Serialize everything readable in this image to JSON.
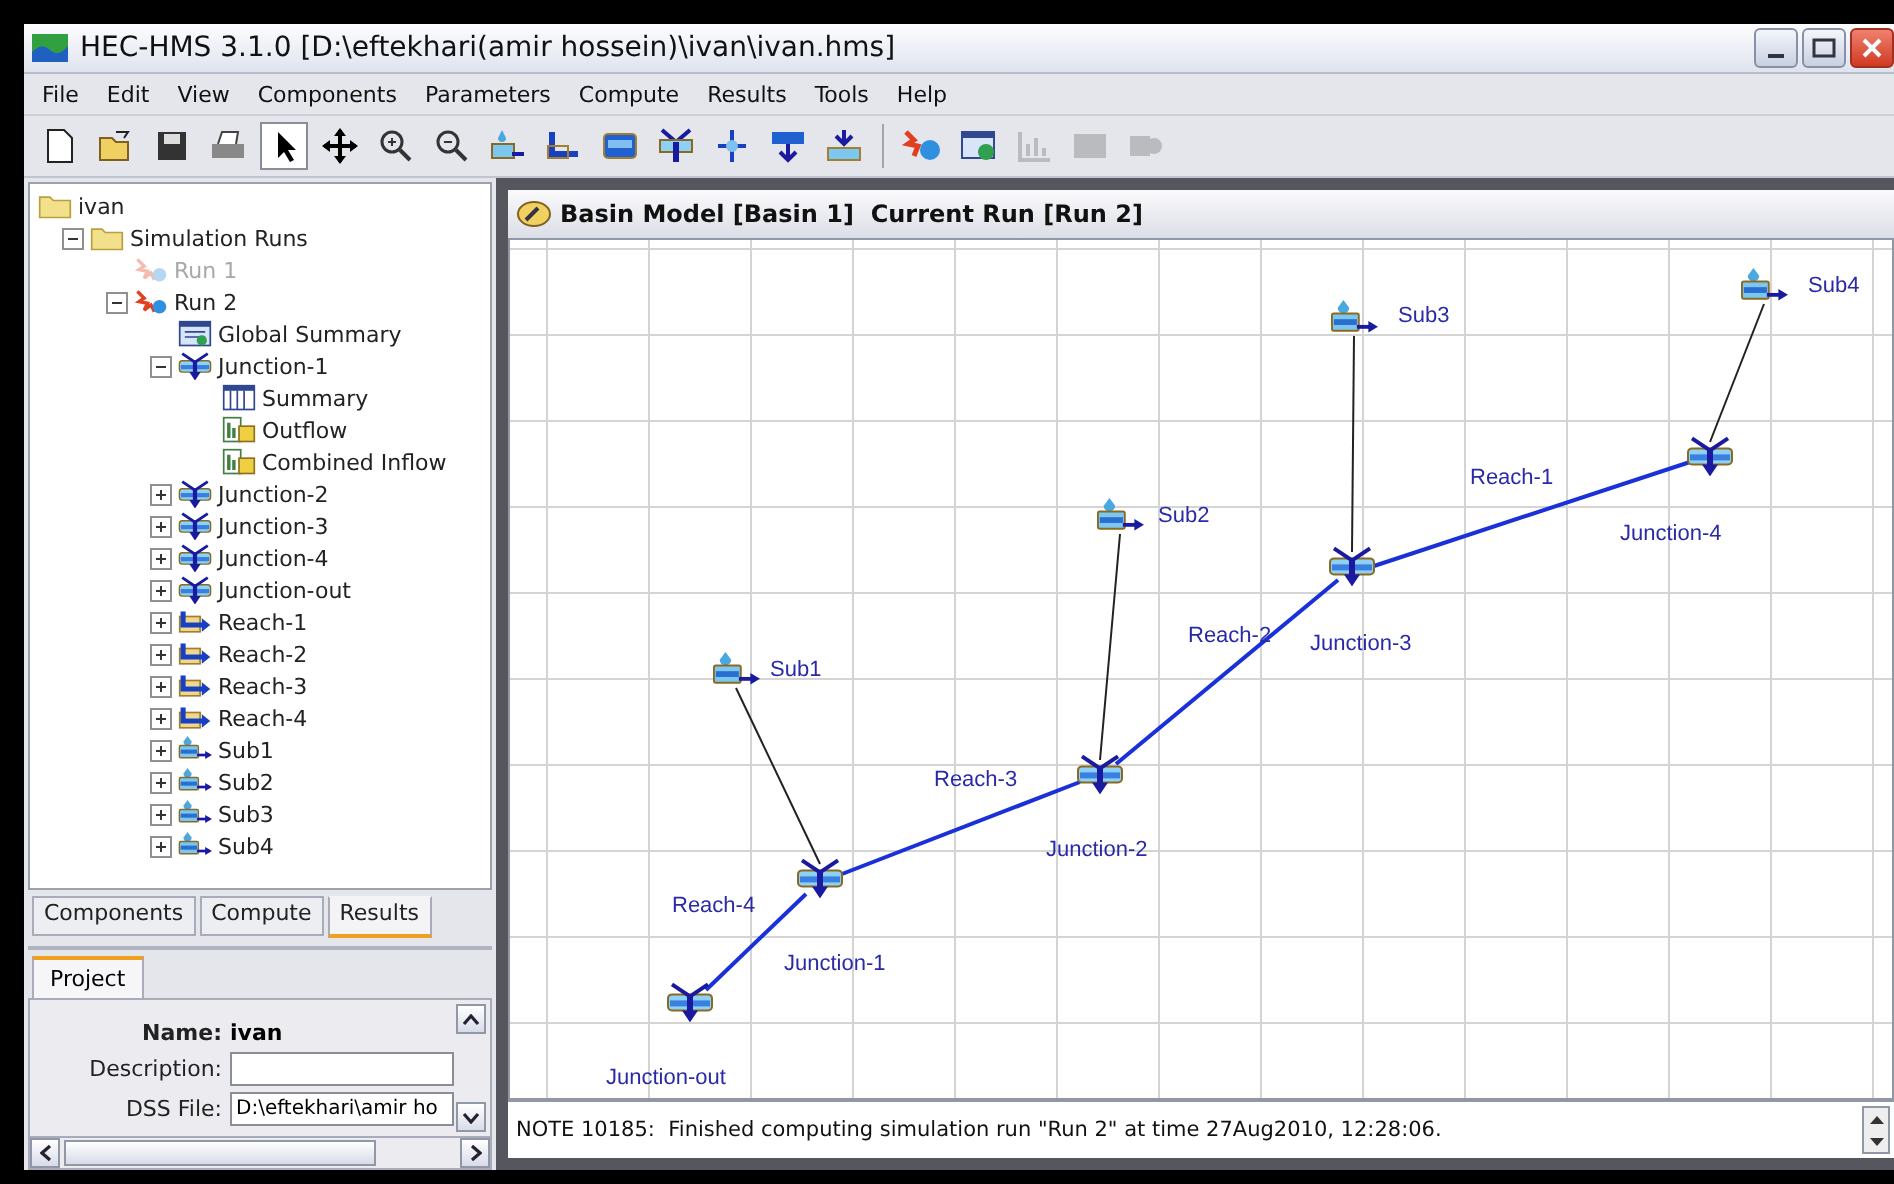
{
  "window": {
    "title": "HEC-HMS 3.1.0 [D:\\eftekhari(amir hossein)\\ivan\\ivan.hms]"
  },
  "menu": [
    "File",
    "Edit",
    "View",
    "Components",
    "Parameters",
    "Compute",
    "Results",
    "Tools",
    "Help"
  ],
  "toolbar": [
    {
      "kind": "new",
      "selected": false,
      "disabled": false
    },
    {
      "kind": "open",
      "selected": false,
      "disabled": false
    },
    {
      "kind": "save",
      "selected": false,
      "disabled": false
    },
    {
      "kind": "print",
      "selected": false,
      "disabled": false
    },
    {
      "kind": "select",
      "selected": true,
      "disabled": false
    },
    {
      "kind": "pan",
      "selected": false,
      "disabled": false
    },
    {
      "kind": "zoom-in",
      "selected": false,
      "disabled": false
    },
    {
      "kind": "zoom-out",
      "selected": false,
      "disabled": false
    },
    {
      "kind": "subbasin",
      "selected": false,
      "disabled": false
    },
    {
      "kind": "reach",
      "selected": false,
      "disabled": false
    },
    {
      "kind": "reservoir",
      "selected": false,
      "disabled": false
    },
    {
      "kind": "junction",
      "selected": false,
      "disabled": false
    },
    {
      "kind": "diversion",
      "selected": false,
      "disabled": false
    },
    {
      "kind": "source",
      "selected": false,
      "disabled": false
    },
    {
      "kind": "sink",
      "selected": false,
      "disabled": false
    },
    {
      "kind": "compute",
      "selected": false,
      "disabled": false
    },
    {
      "kind": "summary",
      "selected": false,
      "disabled": false
    },
    {
      "kind": "chart",
      "selected": false,
      "disabled": true
    },
    {
      "kind": "table",
      "selected": false,
      "disabled": true
    },
    {
      "kind": "time-series",
      "selected": false,
      "disabled": true
    }
  ],
  "tree": [
    {
      "label": "ivan",
      "kind": "folder",
      "children": [
        {
          "label": "Simulation Runs",
          "kind": "folder",
          "expanded": true,
          "children": [
            {
              "label": "Run 1",
              "kind": "run",
              "disabled": true
            },
            {
              "label": "Run 2",
              "kind": "run",
              "expanded": true,
              "disabled": false,
              "children": [
                {
                  "label": "Global Summary",
                  "kind": "summary"
                },
                {
                  "label": "Junction-1",
                  "kind": "junction",
                  "expanded": true,
                  "children": [
                    {
                      "label": "Summary",
                      "kind": "table"
                    },
                    {
                      "label": "Outflow",
                      "kind": "graph"
                    },
                    {
                      "label": "Combined Inflow",
                      "kind": "graph"
                    }
                  ]
                },
                {
                  "label": "Junction-2",
                  "kind": "junction",
                  "expanded": false
                },
                {
                  "label": "Junction-3",
                  "kind": "junction",
                  "expanded": false
                },
                {
                  "label": "Junction-4",
                  "kind": "junction",
                  "expanded": false
                },
                {
                  "label": "Junction-out",
                  "kind": "junction",
                  "expanded": false
                },
                {
                  "label": "Reach-1",
                  "kind": "reach",
                  "expanded": false
                },
                {
                  "label": "Reach-2",
                  "kind": "reach",
                  "expanded": false
                },
                {
                  "label": "Reach-3",
                  "kind": "reach",
                  "expanded": false
                },
                {
                  "label": "Reach-4",
                  "kind": "reach",
                  "expanded": false
                },
                {
                  "label": "Sub1",
                  "kind": "subbasin",
                  "expanded": false
                },
                {
                  "label": "Sub2",
                  "kind": "subbasin",
                  "expanded": false
                },
                {
                  "label": "Sub3",
                  "kind": "subbasin",
                  "expanded": false
                },
                {
                  "label": "Sub4",
                  "kind": "subbasin",
                  "expanded": false
                }
              ]
            }
          ]
        }
      ]
    }
  ],
  "explorer_tabs": [
    {
      "label": "Components",
      "selected": false
    },
    {
      "label": "Compute",
      "selected": false
    },
    {
      "label": "Results",
      "selected": true
    }
  ],
  "project": {
    "tab": "Project",
    "name_label": "Name:",
    "name": "ivan",
    "description_label": "Description:",
    "dss_label": "DSS File:",
    "dss_value": "D:\\eftekhari\\amir ho"
  },
  "basin_model": {
    "title": "Basin Model [Basin 1]  Current Run [Run 2]",
    "nodes": [
      {
        "kind": "subbasin",
        "label": "Sub1"
      },
      {
        "kind": "subbasin",
        "label": "Sub2"
      },
      {
        "kind": "subbasin",
        "label": "Sub3"
      },
      {
        "kind": "subbasin",
        "label": "Sub4"
      },
      {
        "kind": "junction",
        "label": "Junction-out"
      },
      {
        "kind": "junction",
        "label": "Junction-1"
      },
      {
        "kind": "junction",
        "label": "Junction-2"
      },
      {
        "kind": "junction",
        "label": "Junction-3"
      },
      {
        "kind": "junction",
        "label": "Junction-4"
      }
    ],
    "reaches": [
      {
        "label": "Reach-1"
      },
      {
        "label": "Reach-2"
      },
      {
        "label": "Reach-3"
      },
      {
        "label": "Reach-4"
      }
    ]
  },
  "status_bar": {
    "message": "NOTE 10185:  Finished computing simulation run \"Run 2\" at time 27Aug2010, 12:28:06."
  }
}
